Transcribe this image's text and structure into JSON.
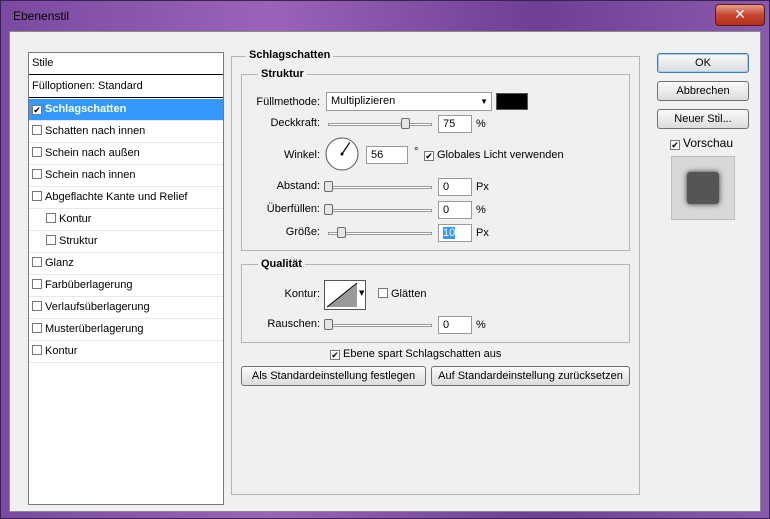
{
  "window": {
    "title": "Ebenenstil",
    "close_label": "✕"
  },
  "styles": {
    "header": "Stile",
    "options_label": "Fülloptionen: Standard",
    "items": [
      {
        "label": "Schlagschatten",
        "checked": true,
        "selected": true,
        "indent": false
      },
      {
        "label": "Schatten nach innen",
        "checked": false,
        "indent": false
      },
      {
        "label": "Schein nach außen",
        "checked": false,
        "indent": false
      },
      {
        "label": "Schein nach innen",
        "checked": false,
        "indent": false
      },
      {
        "label": "Abgeflachte Kante und Relief",
        "checked": false,
        "indent": false
      },
      {
        "label": "Kontur",
        "checked": false,
        "indent": true
      },
      {
        "label": "Struktur",
        "checked": false,
        "indent": true
      },
      {
        "label": "Glanz",
        "checked": false,
        "indent": false
      },
      {
        "label": "Farbüberlagerung",
        "checked": false,
        "indent": false
      },
      {
        "label": "Verlaufsüberlagerung",
        "checked": false,
        "indent": false
      },
      {
        "label": "Musterüberlagerung",
        "checked": false,
        "indent": false
      },
      {
        "label": "Kontur",
        "checked": false,
        "indent": false
      }
    ]
  },
  "panel": {
    "title": "Schlagschatten",
    "structure": {
      "title": "Struktur",
      "blend_mode_label": "Füllmethode:",
      "blend_mode_value": "Multiplizieren",
      "shadow_color": "#000000",
      "opacity_label": "Deckkraft:",
      "opacity_value": "75",
      "opacity_unit": "%",
      "opacity_fraction": 0.75,
      "angle_label": "Winkel:",
      "angle_value": "56",
      "angle_unit": "°",
      "global_light_label": "Globales Licht verwenden",
      "distance_label": "Abstand:",
      "distance_value": "0",
      "distance_unit": "Px",
      "spread_label": "Überfüllen:",
      "spread_value": "0",
      "spread_unit": "%",
      "size_label": "Größe:",
      "size_value": "10",
      "size_unit": "Px"
    },
    "quality": {
      "title": "Qualität",
      "contour_label": "Kontur:",
      "smooth_label": "Glätten",
      "noise_label": "Rauschen:",
      "noise_value": "0",
      "noise_unit": "%"
    },
    "knockout_label": "Ebene spart Schlagschatten aus",
    "set_default_label": "Als Standardeinstellung festlegen",
    "reset_default_label": "Auf Standardeinstellung zurücksetzen"
  },
  "buttons": {
    "ok": "OK",
    "cancel": "Abbrechen",
    "new_style": "Neuer Stil...",
    "preview_label": "Vorschau"
  }
}
